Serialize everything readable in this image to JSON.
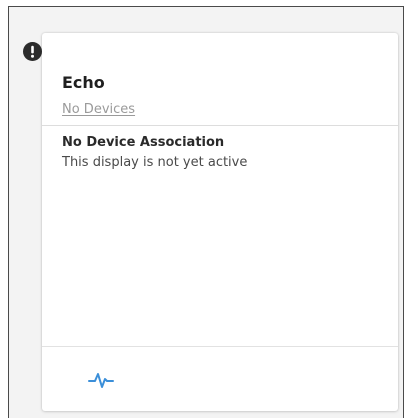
{
  "card": {
    "title": "Echo",
    "devices_link": "No Devices",
    "status_heading": "No Device Association",
    "status_text": "This display is not yet active"
  },
  "icons": {
    "alert": "exclamation-circle-icon",
    "activity": "pulse-icon"
  },
  "colors": {
    "accent": "#3b8fd9",
    "badge": "#2b2b2b",
    "muted_text": "#9a9a9a"
  }
}
